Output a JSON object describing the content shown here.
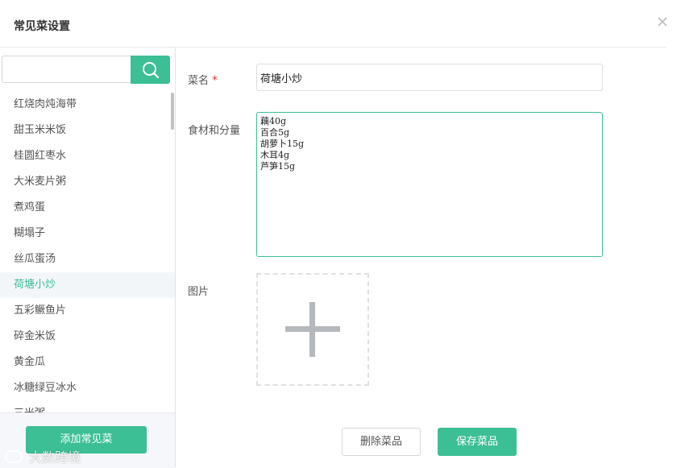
{
  "dialog": {
    "title": "常见菜设置"
  },
  "search": {
    "value": "",
    "placeholder": ""
  },
  "list": {
    "items": [
      "红烧肉炖海带",
      "甜玉米米饭",
      "桂圆红枣水",
      "大米麦片粥",
      "煮鸡蛋",
      "糊塌子",
      "丝瓜蛋汤",
      "荷塘小炒",
      "五彩鳜鱼片",
      "碎金米饭",
      "黄金瓜",
      "冰糖绿豆冰水",
      "三米粥"
    ],
    "active_index": 7
  },
  "sidebar": {
    "add_label": "添加常见菜"
  },
  "form": {
    "name_label": "菜名",
    "required_mark": "*",
    "name_value": "荷塘小炒",
    "ingredients_label": "食材和分量",
    "ingredients_value": "藕40g\n百合5g\n胡萝卜15g\n木耳4g\n芦笋15g",
    "image_label": "图片"
  },
  "actions": {
    "delete_label": "删除菜品",
    "save_label": "保存菜品"
  },
  "watermark": {
    "text": "大数跨境"
  },
  "colors": {
    "accent": "#3cbf95",
    "active_bg": "#f3f6f9",
    "required": "#e04040"
  },
  "icons": {
    "search": "search-icon",
    "close": "close-icon",
    "upload": "plus-icon"
  }
}
